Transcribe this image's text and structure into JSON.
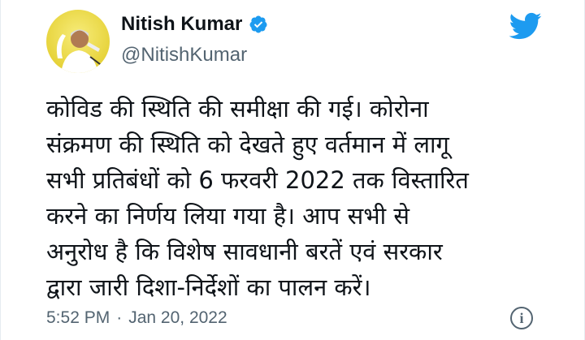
{
  "author": {
    "name": "Nitish Kumar",
    "handle": "@NitishKumar",
    "verified_icon": "verified-badge-icon",
    "verified_color": "#1d9bf0"
  },
  "brand": {
    "icon": "twitter-bird-icon",
    "color": "#1d9bf0"
  },
  "tweet": {
    "text": "कोविड की स्थिति की समीक्षा की गई। कोरोना\nसंक्रमण की स्थिति को देखते हुए वर्तमान में लागू\nसभी प्रतिबंधों को 6 फरवरी 2022 तक विस्तारित\nकरने का निर्णय लिया गया है। आप सभी से\nअनुरोध है कि विशेष सावधानी बरतें एवं सरकार\nद्वारा जारी दिशा-निर्देशों का पालन करें।"
  },
  "meta": {
    "time": "5:52 PM",
    "separator": "·",
    "date": "Jan 20, 2022",
    "info_glyph": "i",
    "info_icon": "info-icon"
  }
}
